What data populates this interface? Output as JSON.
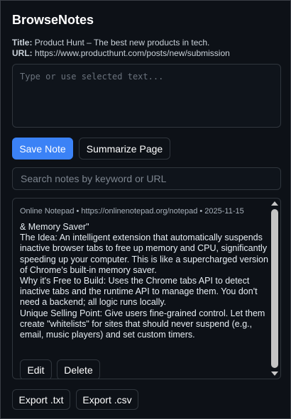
{
  "app": {
    "title": "BrowseNotes"
  },
  "page_info": {
    "title_label": "Title:",
    "title_value": "Product Hunt – The best new products in tech.",
    "url_label": "URL:",
    "url_value": "https://www.producthunt.com/posts/new/submission"
  },
  "note_input": {
    "placeholder": "Type or use selected text...",
    "value": ""
  },
  "actions": {
    "save_label": "Save Note",
    "summarize_label": "Summarize Page"
  },
  "search": {
    "placeholder": "Search notes by keyword or URL",
    "value": ""
  },
  "notes": [
    {
      "meta": "Online Notepad • https://onlinenotepad.org/notepad • 2025-11-15",
      "lines": [
        "& Memory Saver\"",
        "The Idea: An intelligent extension that automatically suspends inactive browser tabs to free up memory and CPU, significantly speeding up your computer. This is like a supercharged version of Chrome's built-in memory saver.",
        "Why it's Free to Build: Uses the Chrome tabs API to detect inactive tabs and the runtime API to manage them. You don't need a backend; all logic runs locally.",
        "Unique Selling Point: Give users fine-grained control. Let them create \"whitelists\" for sites that should never suspend (e.g., email, music players) and set custom timers."
      ],
      "edit_label": "Edit",
      "delete_label": "Delete"
    }
  ],
  "export": {
    "txt_label": "Export .txt",
    "csv_label": "Export .csv"
  },
  "colors": {
    "background": "#0d1117",
    "border": "#30363d",
    "accent": "#3b82f6",
    "text": "#e6edf3"
  }
}
